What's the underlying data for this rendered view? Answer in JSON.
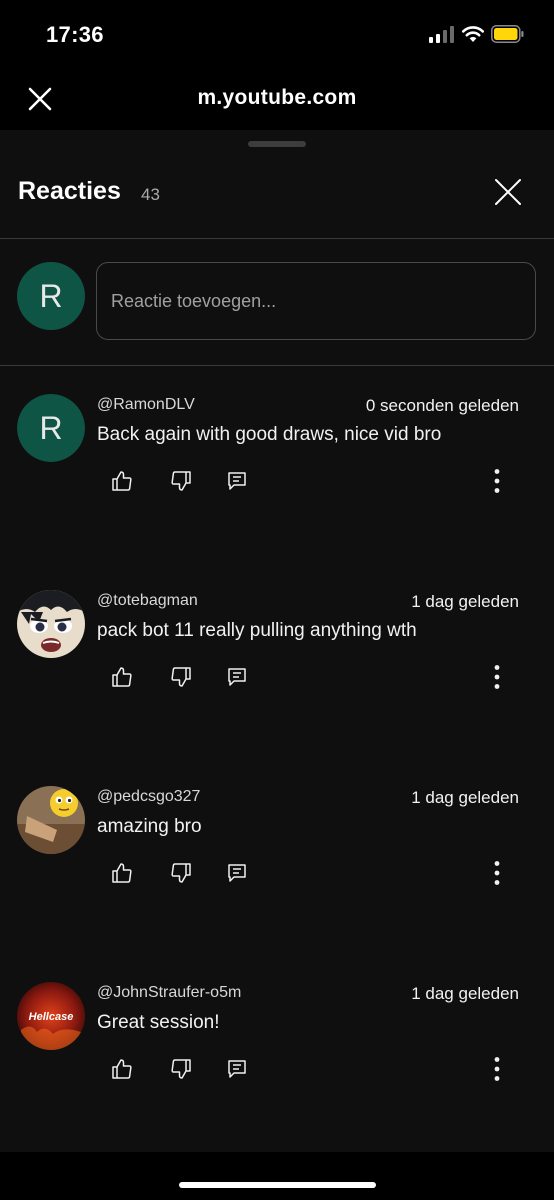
{
  "status_bar": {
    "time": "17:36"
  },
  "browser": {
    "url": "m.youtube.com"
  },
  "sheet": {
    "title": "Reacties",
    "count": "43"
  },
  "composer": {
    "avatar_letter": "R",
    "placeholder": "Reactie toevoegen..."
  },
  "comments": [
    {
      "author": "@RamonDLV",
      "time": "0 seconden geleden",
      "text": "Back again with good draws, nice vid bro",
      "avatar_letter": "R"
    },
    {
      "author": "@totebagman",
      "time": "1 dag geleden",
      "text": "pack bot 11 really pulling anything wth"
    },
    {
      "author": "@pedcsgo327",
      "time": "1 dag geleden",
      "text": "amazing bro"
    },
    {
      "author": "@JohnStraufer-o5m",
      "time": "1 dag geleden",
      "text": "Great session!",
      "avatar_logo_text": "Hellcase"
    }
  ],
  "colors": {
    "sheet_bg": "#0f0f0f",
    "avatar_bg": "#0f5546",
    "battery": "#ffd60a"
  },
  "icons": [
    "signal-icon",
    "wifi-icon",
    "battery-icon",
    "close-icon",
    "like-icon",
    "dislike-icon",
    "reply-icon",
    "more-icon"
  ]
}
